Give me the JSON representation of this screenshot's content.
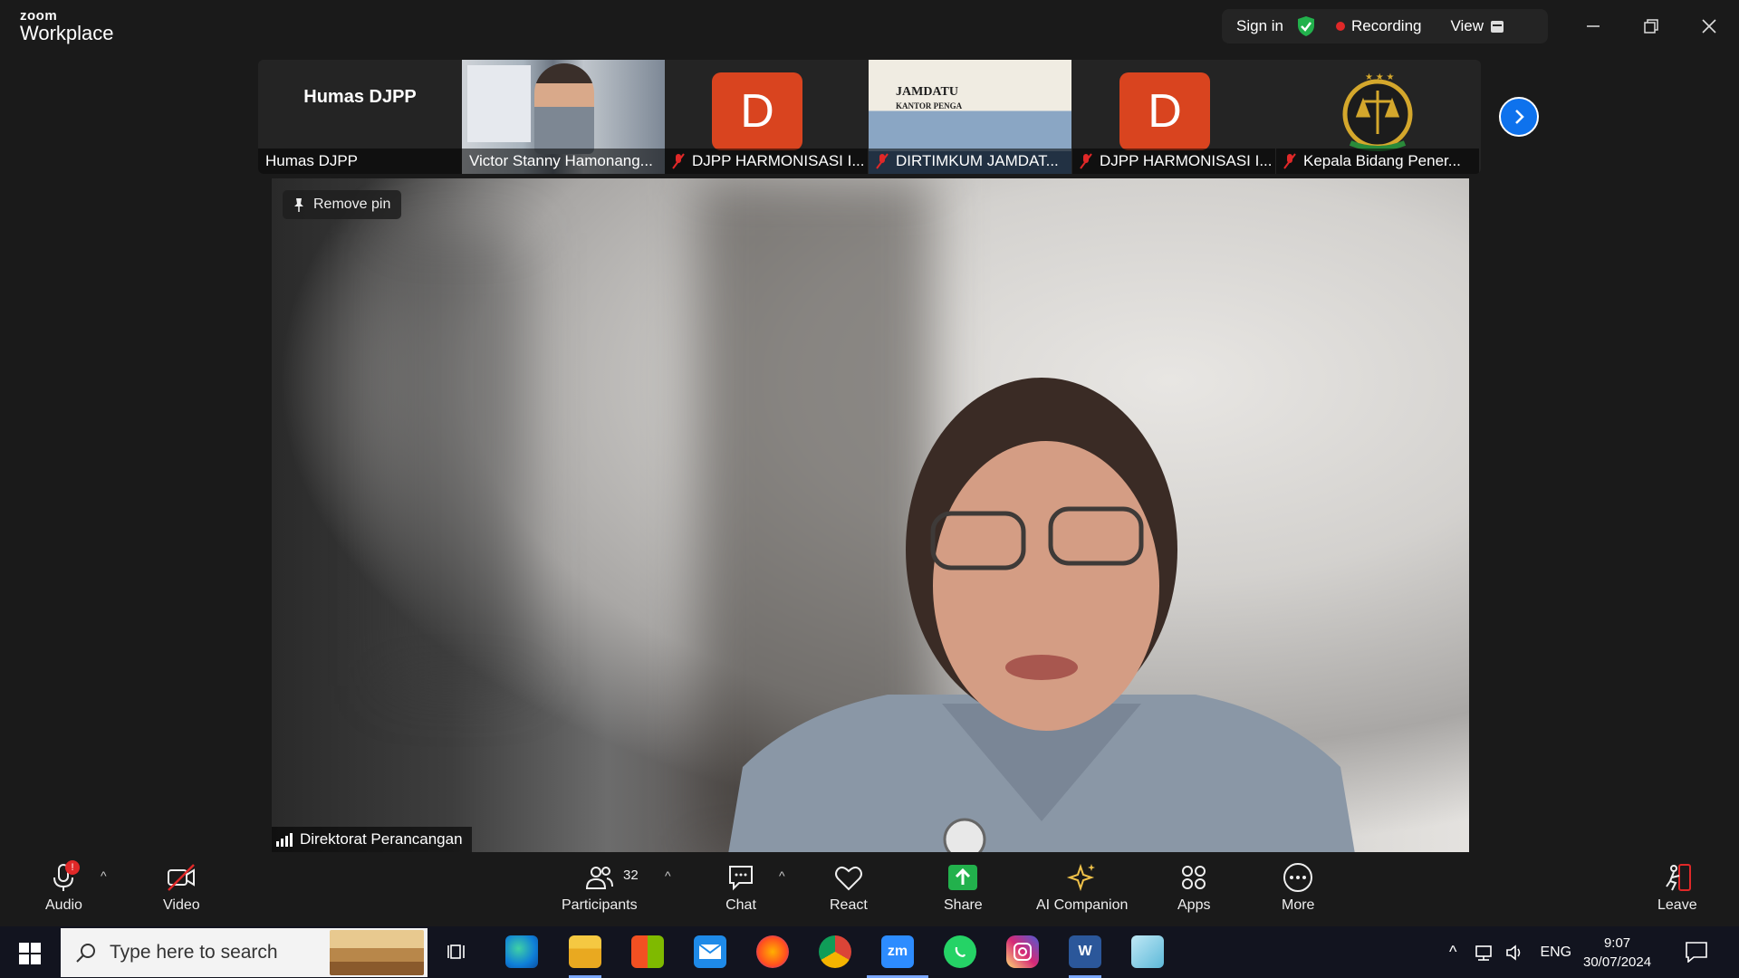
{
  "app": {
    "brand_top": "zoom",
    "brand_bottom": "Workplace"
  },
  "titlebar": {
    "sign_in": "Sign in",
    "recording": "Recording",
    "view": "View"
  },
  "thumbnails": [
    {
      "display": "Humas DJPP",
      "label": "Humas DJPP",
      "muted": false
    },
    {
      "label": "Victor Stanny Hamonang...",
      "muted": false
    },
    {
      "avatar": "D",
      "label": "DJPP HARMONISASI I...",
      "muted": true
    },
    {
      "label": "DIRTIMKUM JAMDAT...",
      "muted": true,
      "sign_line1": "JAMDATU",
      "sign_line2": "KANTOR PENGA"
    },
    {
      "avatar": "D",
      "label": "DJPP HARMONISASI I...",
      "muted": true
    },
    {
      "label": "Kepala Bidang Pener...",
      "muted": true
    }
  ],
  "main": {
    "remove_pin": "Remove pin",
    "speaker": "Direktorat Perancangan"
  },
  "toolbar": {
    "audio": "Audio",
    "video": "Video",
    "participants": "Participants",
    "participant_count": "32",
    "chat": "Chat",
    "react": "React",
    "share": "Share",
    "ai_companion": "AI Companion",
    "apps": "Apps",
    "more": "More",
    "leave": "Leave",
    "audio_badge": "!"
  },
  "taskbar": {
    "search_placeholder": "Type here to search",
    "language": "ENG",
    "time": "9:07",
    "date": "30/07/2024",
    "zoom_icon_text": "zm",
    "word_icon_text": "W"
  },
  "colors": {
    "accent_blue": "#0e72ed",
    "record_red": "#e02828",
    "avatar_orange": "#d9441f",
    "share_green": "#22b14c"
  }
}
